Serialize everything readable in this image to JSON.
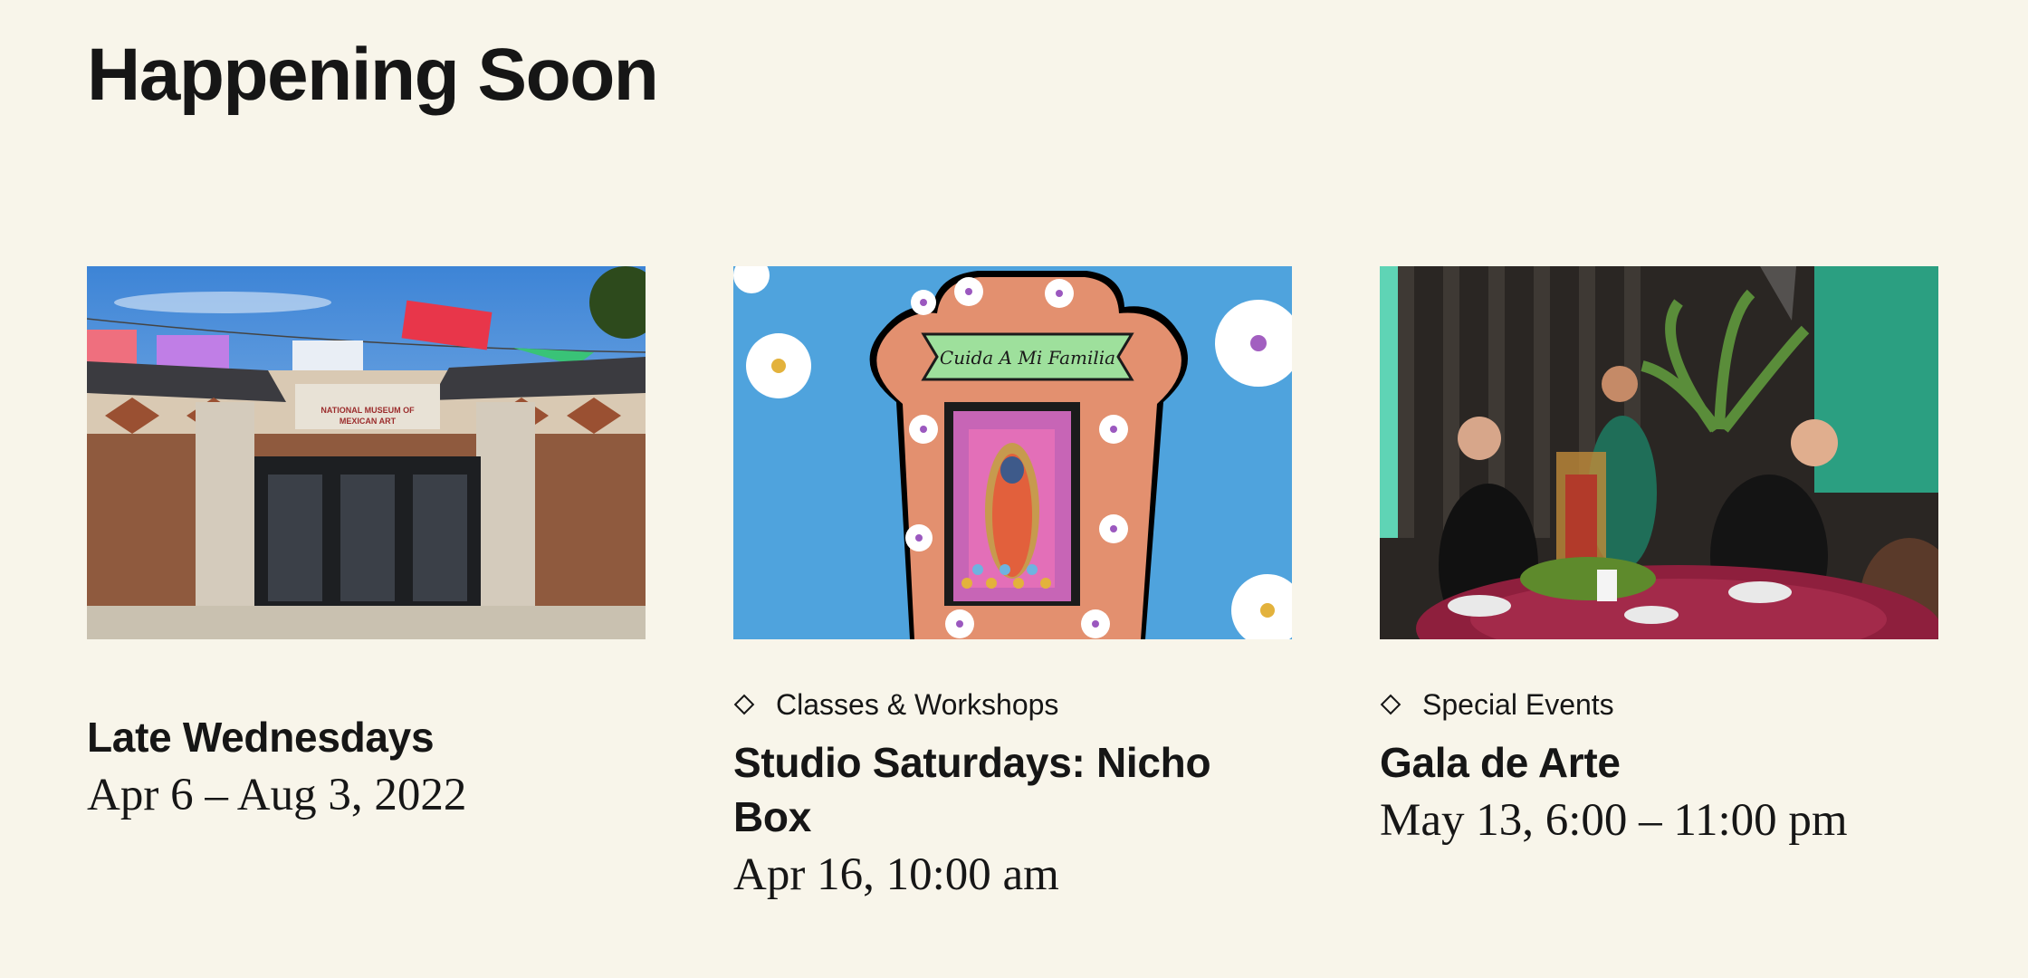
{
  "section": {
    "title": "Happening Soon"
  },
  "events": [
    {
      "category": "",
      "title": "Late Wednesdays",
      "date": "Apr 6 – Aug 3, 2022",
      "image": "museum-facade-photo"
    },
    {
      "category": "Classes & Workshops",
      "title": "Studio Saturdays: Nicho Box",
      "date": "Apr 16, 10:00 am",
      "image": "nicho-box-illustration",
      "banner_text": "Cuida A Mi Familia"
    },
    {
      "category": "Special Events",
      "title": "Gala de Arte",
      "date": "May 13, 6:00 – 11:00 pm",
      "image": "gala-dinner-photo"
    }
  ],
  "museum_sign": [
    "NATIONAL MUSEUM OF",
    "MEXICAN ART"
  ],
  "colors": {
    "background": "#f8f5ea",
    "text": "#161616",
    "sky": "#4fa3dd",
    "nicho_orange": "#e3906f",
    "table_cloth": "#8e1f3d"
  },
  "icons": {
    "category_marker": "diamond-outline-icon"
  }
}
